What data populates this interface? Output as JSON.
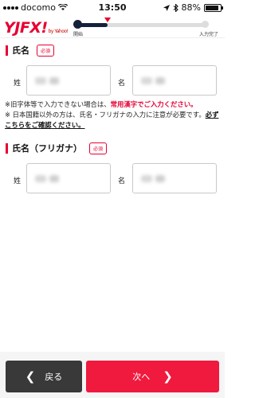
{
  "status_bar": {
    "carrier": "docomo",
    "time": "13:50",
    "battery": "88%",
    "battery_level": 0.88,
    "icons": [
      "signal-icon",
      "wifi-icon",
      "location-icon",
      "bluetooth-icon",
      "battery-icon"
    ]
  },
  "header": {
    "logo_text": "YJFX!",
    "logo_sub": "by Yahoo!",
    "progress": {
      "start_label": "開始",
      "end_label": "入力完了",
      "fraction": 0.24
    }
  },
  "name_section": {
    "title": "氏名",
    "required_badge": "必須",
    "sei_label": "姓",
    "mei_label": "名"
  },
  "notes": {
    "line1_prefix": "※旧字体等で入力できない場合は、",
    "line1_highlight": "常用漢字でご入力ください。",
    "line2_prefix": "※ 日本国籍以外の方は、氏名・フリガナの入力に注意が必要です。",
    "line2_link": "必ずこちらをご確認ください。"
  },
  "kana_section": {
    "title": "氏名（フリガナ）",
    "required_badge": "必須",
    "sei_label": "姓",
    "mei_label": "名"
  },
  "footer": {
    "back_label": "戻る",
    "next_label": "次へ"
  },
  "colors": {
    "accent": "#e60033",
    "next_button": "#f0193e",
    "back_button": "#393939",
    "progress_fill": "#15203a"
  }
}
